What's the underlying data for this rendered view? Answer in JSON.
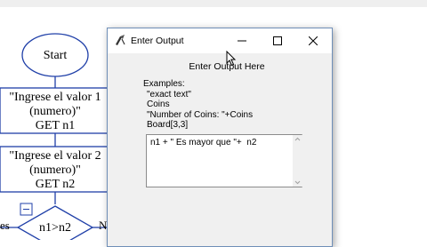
{
  "flowchart": {
    "start_label": "Start",
    "node1_lines": [
      "\"Ingrese el valor 1",
      "(numero)\"",
      "GET n1"
    ],
    "node2_lines": [
      "\"Ingrese el valor 2",
      "(numero)\"",
      "GET n2"
    ],
    "decision_label": "n1>n2",
    "yes_label": "es",
    "no_label": "N"
  },
  "dialog": {
    "title": "Enter Output",
    "heading": "Enter Output Here",
    "examples": [
      "Examples:",
      "\"exact text\"",
      "Coins",
      "\"Number of Coins: \"+Coins",
      "Board[3,3]"
    ],
    "input_value": "n1 + \" Es mayor que \"+  n2"
  },
  "icons": {
    "app": "pen-cursor-icon",
    "minimize": "minimize-icon",
    "maximize": "maximize-icon",
    "close": "close-icon"
  }
}
